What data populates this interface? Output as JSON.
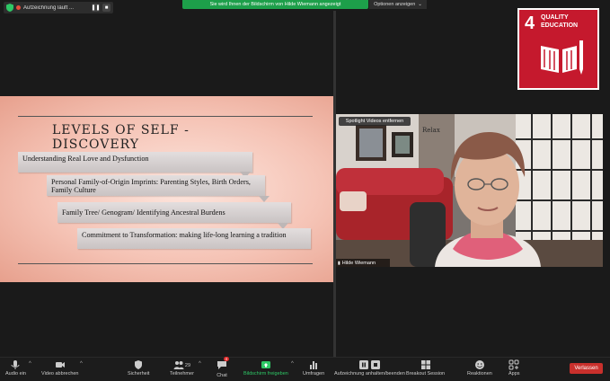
{
  "topbar": {
    "recording_label": "Aufzeichnung läuft ...",
    "share_banner": "Sie wird Ihnen der Bildschirm von Hilde Wiemann angezeigt",
    "view_options": "Optionen anzeigen"
  },
  "slide": {
    "title": "LEVELS OF SELF - DISCOVERY",
    "steps": [
      "Understanding Real Love and Dysfunction",
      "Personal Family-of-Origin Imprints: Parenting Styles, Birth Orders, Family Culture",
      "Family Tree/ Genogram/ Identifying Ancestral Burdens",
      "Commitment to Transformation: making life-long learning a tradition"
    ]
  },
  "video": {
    "spotlight_button": "Spotlight Videos entfernen",
    "participant_name": "Hilde Wiemann",
    "wall_sign": "Relax"
  },
  "sdg": {
    "number": "4",
    "line1": "QUALITY",
    "line2": "EDUCATION",
    "color": "#c5192d"
  },
  "toolbar": {
    "audio": "Audio ein",
    "video": "Video abbrechen",
    "security": "Sicherheit",
    "participants": "Teilnehmer",
    "participants_count": "29",
    "chat": "Chat",
    "chat_badge": "4",
    "share": "Bildschirm freigeben",
    "polls": "Umfragen",
    "record": "Aufzeichnung anhalten/beenden",
    "breakout": "Breakout Session",
    "reactions": "Reaktionen",
    "apps": "Apps",
    "leave": "Verlassen",
    "accent_green": "#2ec866",
    "leave_red": "#c9302c"
  }
}
